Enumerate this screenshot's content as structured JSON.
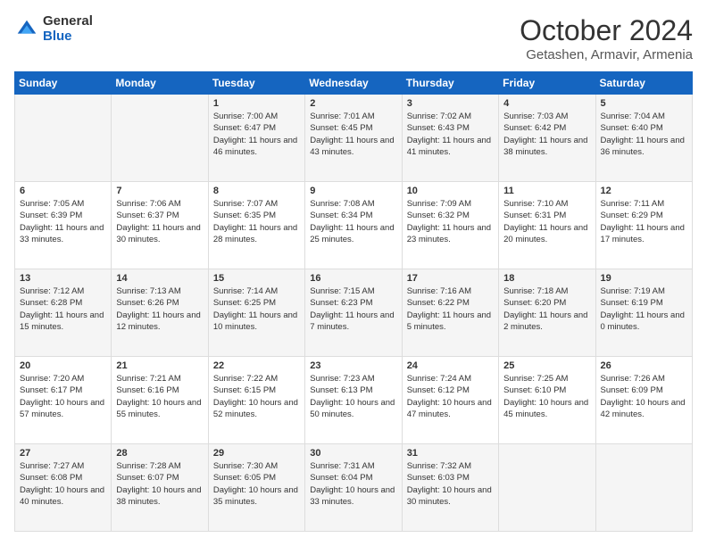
{
  "header": {
    "logo": {
      "general": "General",
      "blue": "Blue"
    },
    "title": "October 2024",
    "subtitle": "Getashen, Armavir, Armenia"
  },
  "days_of_week": [
    "Sunday",
    "Monday",
    "Tuesday",
    "Wednesday",
    "Thursday",
    "Friday",
    "Saturday"
  ],
  "weeks": [
    [
      {
        "day": "",
        "sunrise": "",
        "sunset": "",
        "daylight": ""
      },
      {
        "day": "",
        "sunrise": "",
        "sunset": "",
        "daylight": ""
      },
      {
        "day": "1",
        "sunrise": "Sunrise: 7:00 AM",
        "sunset": "Sunset: 6:47 PM",
        "daylight": "Daylight: 11 hours and 46 minutes."
      },
      {
        "day": "2",
        "sunrise": "Sunrise: 7:01 AM",
        "sunset": "Sunset: 6:45 PM",
        "daylight": "Daylight: 11 hours and 43 minutes."
      },
      {
        "day": "3",
        "sunrise": "Sunrise: 7:02 AM",
        "sunset": "Sunset: 6:43 PM",
        "daylight": "Daylight: 11 hours and 41 minutes."
      },
      {
        "day": "4",
        "sunrise": "Sunrise: 7:03 AM",
        "sunset": "Sunset: 6:42 PM",
        "daylight": "Daylight: 11 hours and 38 minutes."
      },
      {
        "day": "5",
        "sunrise": "Sunrise: 7:04 AM",
        "sunset": "Sunset: 6:40 PM",
        "daylight": "Daylight: 11 hours and 36 minutes."
      }
    ],
    [
      {
        "day": "6",
        "sunrise": "Sunrise: 7:05 AM",
        "sunset": "Sunset: 6:39 PM",
        "daylight": "Daylight: 11 hours and 33 minutes."
      },
      {
        "day": "7",
        "sunrise": "Sunrise: 7:06 AM",
        "sunset": "Sunset: 6:37 PM",
        "daylight": "Daylight: 11 hours and 30 minutes."
      },
      {
        "day": "8",
        "sunrise": "Sunrise: 7:07 AM",
        "sunset": "Sunset: 6:35 PM",
        "daylight": "Daylight: 11 hours and 28 minutes."
      },
      {
        "day": "9",
        "sunrise": "Sunrise: 7:08 AM",
        "sunset": "Sunset: 6:34 PM",
        "daylight": "Daylight: 11 hours and 25 minutes."
      },
      {
        "day": "10",
        "sunrise": "Sunrise: 7:09 AM",
        "sunset": "Sunset: 6:32 PM",
        "daylight": "Daylight: 11 hours and 23 minutes."
      },
      {
        "day": "11",
        "sunrise": "Sunrise: 7:10 AM",
        "sunset": "Sunset: 6:31 PM",
        "daylight": "Daylight: 11 hours and 20 minutes."
      },
      {
        "day": "12",
        "sunrise": "Sunrise: 7:11 AM",
        "sunset": "Sunset: 6:29 PM",
        "daylight": "Daylight: 11 hours and 17 minutes."
      }
    ],
    [
      {
        "day": "13",
        "sunrise": "Sunrise: 7:12 AM",
        "sunset": "Sunset: 6:28 PM",
        "daylight": "Daylight: 11 hours and 15 minutes."
      },
      {
        "day": "14",
        "sunrise": "Sunrise: 7:13 AM",
        "sunset": "Sunset: 6:26 PM",
        "daylight": "Daylight: 11 hours and 12 minutes."
      },
      {
        "day": "15",
        "sunrise": "Sunrise: 7:14 AM",
        "sunset": "Sunset: 6:25 PM",
        "daylight": "Daylight: 11 hours and 10 minutes."
      },
      {
        "day": "16",
        "sunrise": "Sunrise: 7:15 AM",
        "sunset": "Sunset: 6:23 PM",
        "daylight": "Daylight: 11 hours and 7 minutes."
      },
      {
        "day": "17",
        "sunrise": "Sunrise: 7:16 AM",
        "sunset": "Sunset: 6:22 PM",
        "daylight": "Daylight: 11 hours and 5 minutes."
      },
      {
        "day": "18",
        "sunrise": "Sunrise: 7:18 AM",
        "sunset": "Sunset: 6:20 PM",
        "daylight": "Daylight: 11 hours and 2 minutes."
      },
      {
        "day": "19",
        "sunrise": "Sunrise: 7:19 AM",
        "sunset": "Sunset: 6:19 PM",
        "daylight": "Daylight: 11 hours and 0 minutes."
      }
    ],
    [
      {
        "day": "20",
        "sunrise": "Sunrise: 7:20 AM",
        "sunset": "Sunset: 6:17 PM",
        "daylight": "Daylight: 10 hours and 57 minutes."
      },
      {
        "day": "21",
        "sunrise": "Sunrise: 7:21 AM",
        "sunset": "Sunset: 6:16 PM",
        "daylight": "Daylight: 10 hours and 55 minutes."
      },
      {
        "day": "22",
        "sunrise": "Sunrise: 7:22 AM",
        "sunset": "Sunset: 6:15 PM",
        "daylight": "Daylight: 10 hours and 52 minutes."
      },
      {
        "day": "23",
        "sunrise": "Sunrise: 7:23 AM",
        "sunset": "Sunset: 6:13 PM",
        "daylight": "Daylight: 10 hours and 50 minutes."
      },
      {
        "day": "24",
        "sunrise": "Sunrise: 7:24 AM",
        "sunset": "Sunset: 6:12 PM",
        "daylight": "Daylight: 10 hours and 47 minutes."
      },
      {
        "day": "25",
        "sunrise": "Sunrise: 7:25 AM",
        "sunset": "Sunset: 6:10 PM",
        "daylight": "Daylight: 10 hours and 45 minutes."
      },
      {
        "day": "26",
        "sunrise": "Sunrise: 7:26 AM",
        "sunset": "Sunset: 6:09 PM",
        "daylight": "Daylight: 10 hours and 42 minutes."
      }
    ],
    [
      {
        "day": "27",
        "sunrise": "Sunrise: 7:27 AM",
        "sunset": "Sunset: 6:08 PM",
        "daylight": "Daylight: 10 hours and 40 minutes."
      },
      {
        "day": "28",
        "sunrise": "Sunrise: 7:28 AM",
        "sunset": "Sunset: 6:07 PM",
        "daylight": "Daylight: 10 hours and 38 minutes."
      },
      {
        "day": "29",
        "sunrise": "Sunrise: 7:30 AM",
        "sunset": "Sunset: 6:05 PM",
        "daylight": "Daylight: 10 hours and 35 minutes."
      },
      {
        "day": "30",
        "sunrise": "Sunrise: 7:31 AM",
        "sunset": "Sunset: 6:04 PM",
        "daylight": "Daylight: 10 hours and 33 minutes."
      },
      {
        "day": "31",
        "sunrise": "Sunrise: 7:32 AM",
        "sunset": "Sunset: 6:03 PM",
        "daylight": "Daylight: 10 hours and 30 minutes."
      },
      {
        "day": "",
        "sunrise": "",
        "sunset": "",
        "daylight": ""
      },
      {
        "day": "",
        "sunrise": "",
        "sunset": "",
        "daylight": ""
      }
    ]
  ]
}
